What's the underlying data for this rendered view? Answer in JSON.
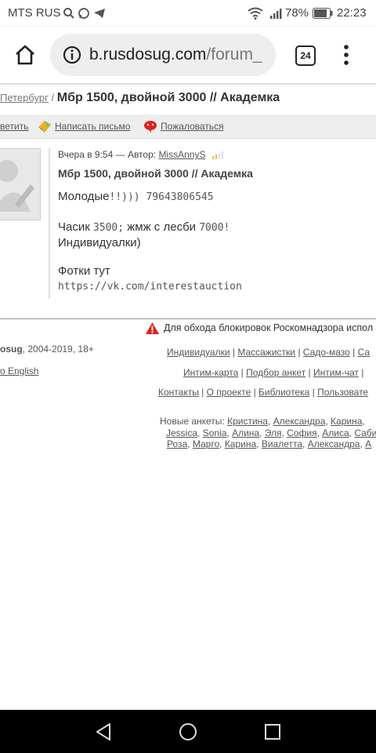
{
  "status_bar": {
    "carrier": "MTS RUS",
    "battery": "78%",
    "time": "22:23",
    "icons": [
      "search-icon",
      "whatsapp-icon",
      "telegram-icon",
      "wifi-icon",
      "signal-icon",
      "battery-icon"
    ]
  },
  "browser": {
    "url_domain": "b.rusdosug.com",
    "url_path": "/forum_",
    "tab_count": "24"
  },
  "breadcrumb": {
    "city_link": "Петербург",
    "separator": " / ",
    "title": "Мбр 1500, двойной 3000 // Академка"
  },
  "actions": {
    "reply": "ветить",
    "write_letter": "Написать письмо",
    "complain": "Пожаловаться"
  },
  "post": {
    "meta_prefix": "Вчера в 9:54 — Автор: ",
    "author": "MissAnnyS",
    "title": "Мбр 1500, двойной 3000 // Академка",
    "line1_a": "Молодые",
    "line1_b": "!!)))  79643806545",
    "line2_a": "Часик ",
    "line2_b": "3500;",
    "line2_c": " жмж с лесби ",
    "line2_d": "7000!",
    "line3": "Индивидуалки)",
    "line4": "Фотки тут",
    "line5": "https://vk.com/interestauction"
  },
  "footer": {
    "warning": "Для обхода блокировок Роскомнадзора испол",
    "copyright_site": "osug",
    "copyright_rest": ", 2004-2019, 18+",
    "lang": "o English",
    "row1": [
      "Индивидуалки",
      "Массажистки",
      "Садо-мазо",
      "Са"
    ],
    "row2": [
      "Интим-карта",
      "Подбор анкет",
      "Интим-чат",
      ""
    ],
    "row3": [
      "Контакты",
      "О проекте",
      "Библиотека",
      "Пользовате"
    ],
    "new_label": "Новые анкеты: ",
    "new1": [
      "Кристина",
      "Александра",
      "Карина",
      ""
    ],
    "new2": [
      "Jessica",
      "Sonia",
      "Алина",
      "Эля",
      "София",
      "Алиса",
      "Саби"
    ],
    "new3": [
      "Роза",
      "Марго",
      "Карина",
      "Виалетта",
      "Александра",
      "А"
    ]
  }
}
